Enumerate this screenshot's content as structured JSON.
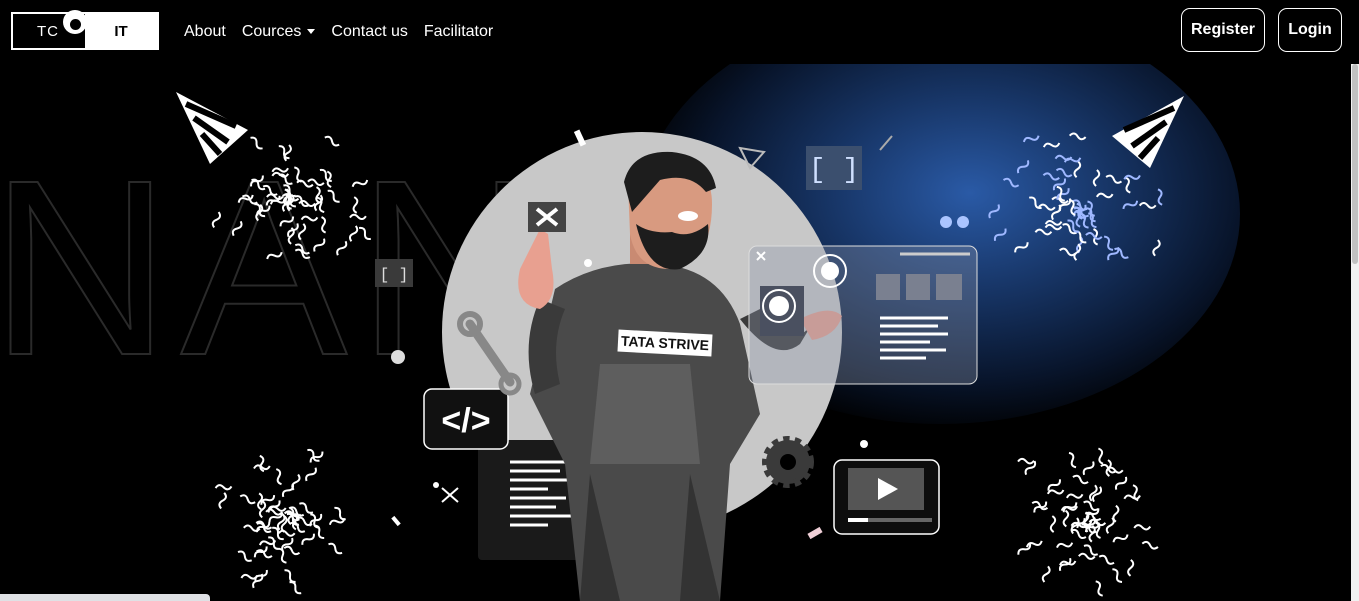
{
  "logo": {
    "left_text": "TC",
    "right_text": "IT"
  },
  "nav": {
    "about": "About",
    "courses": "Cources",
    "contact": "Contact us",
    "facilitator": "Facilitator"
  },
  "auth": {
    "register": "Register",
    "login": "Login"
  },
  "hero": {
    "background_word": "NAND",
    "shirt_text": "TATA STRIVE",
    "code_icon_text": "</>"
  },
  "colors": {
    "background": "#000000",
    "accent_glow": "#2a5aa6",
    "foreground": "#ffffff"
  }
}
